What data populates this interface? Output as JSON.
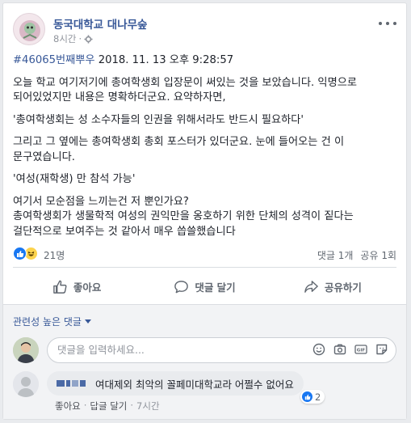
{
  "post": {
    "page_name": "동국대학교 대나무숲",
    "time": "8시간",
    "dot": "·",
    "hashtag": "#46065번째뿌우",
    "date": " 2018. 11. 13 오후 9:28:57",
    "paragraphs": [
      "오늘 학교 여기저기에 총여학생회 입장문이 써있는 것을 보았습니다. 익명으로 되어있었지만 내용은 명확하더군요. 요약하자면,",
      "'총여학생회는 성 소수자들의 인권을 위해서라도 반드시 필요하다'",
      "그리고 그 옆에는 총여학생회 총회 포스터가 있더군요. 눈에 들어오는 건 이 문구였습니다.",
      "'여성(재학생) 만 참석 가능'",
      "여기서 모순점을 느끼는건 저 뿐인가요?\n총여학생회가 생물학적 여성의 권익만을 옹호하기 위한 단체의 성격이 짙다는 걸단적으로 보여주는 것 같아서 매우 씁쓸했습니다"
    ]
  },
  "reactions": {
    "count": "21명",
    "comments": "댓글 1개",
    "shares": "공유 1회"
  },
  "actions": {
    "like": "좋아요",
    "comment": "댓글 달기",
    "share": "공유하기"
  },
  "comments_section": {
    "sort_label": "관련성 높은 댓글",
    "placeholder": "댓글을 입력하세요...",
    "comment": {
      "text": "여대제외 최악의 꼴페미대학교라 어쩔수 없어요",
      "likes": "2",
      "like_label": "좋아요",
      "reply_label": "답글 달기",
      "time": "7시간",
      "sep": "·"
    }
  },
  "colors": {
    "link": "#385898",
    "like_blue": "#1877f2",
    "background": "#e9ebee"
  }
}
